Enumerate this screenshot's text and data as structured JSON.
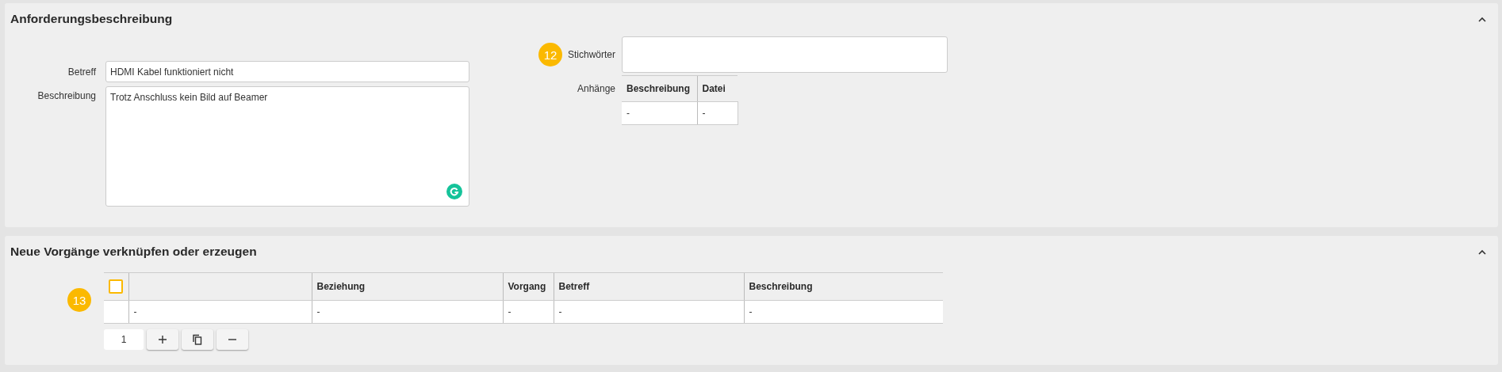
{
  "sections": [
    {
      "title": "Anforderungsbeschreibung",
      "expanded": true,
      "subject": {
        "label": "Betreff",
        "value": "HDMI Kabel funktioniert nicht"
      },
      "description": {
        "label": "Beschreibung",
        "value": "Trotz Anschluss kein Bild auf Beamer"
      },
      "keywords": {
        "badge": "12",
        "label": "Stichwörter"
      },
      "attachments": {
        "label": "Anhänge",
        "columns": [
          "Beschreibung",
          "Datei"
        ],
        "rows": [
          [
            "-",
            "-"
          ]
        ]
      }
    },
    {
      "title": "Neue Vorgänge verknüpfen oder erzeugen",
      "expanded": true,
      "badge": "13",
      "table": {
        "select_all_checked": false,
        "columns": [
          "",
          "Beziehung",
          "Vorgang",
          "Betreff",
          "Beschreibung"
        ],
        "rows": [
          [
            "-",
            "-",
            "-",
            "-",
            "-"
          ]
        ]
      },
      "count": "1"
    }
  ]
}
